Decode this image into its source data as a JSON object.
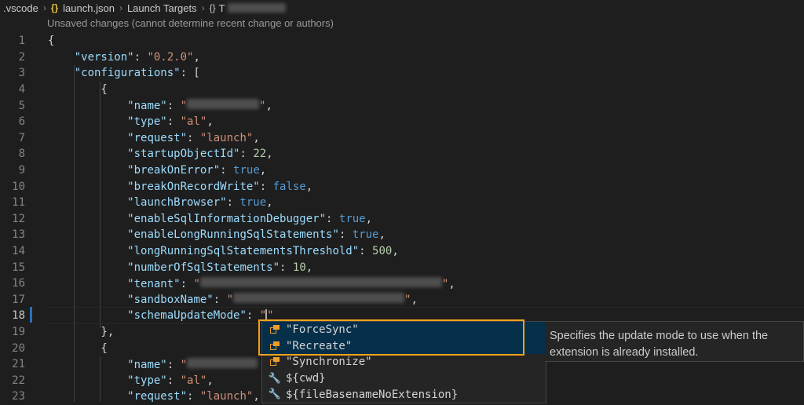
{
  "breadcrumb": {
    "items": [
      ".vscode",
      "launch.json",
      "Launch Targets"
    ],
    "last_prefix": "T"
  },
  "codelens": "Unsaved changes (cannot determine recent change or authors)",
  "editor": {
    "active_line": "18",
    "lines": [
      {
        "ln": "1"
      },
      {
        "ln": "2"
      },
      {
        "ln": "3"
      },
      {
        "ln": "4"
      },
      {
        "ln": "5"
      },
      {
        "ln": "6"
      },
      {
        "ln": "7"
      },
      {
        "ln": "8"
      },
      {
        "ln": "9"
      },
      {
        "ln": "10"
      },
      {
        "ln": "11"
      },
      {
        "ln": "12"
      },
      {
        "ln": "13"
      },
      {
        "ln": "14"
      },
      {
        "ln": "15"
      },
      {
        "ln": "16"
      },
      {
        "ln": "17"
      },
      {
        "ln": "18"
      },
      {
        "ln": "19"
      },
      {
        "ln": "20"
      },
      {
        "ln": "21"
      },
      {
        "ln": "22"
      },
      {
        "ln": "23"
      }
    ],
    "tokens": {
      "version_key": "\"version\"",
      "version_val": "\"0.2.0\"",
      "configurations_key": "\"configurations\"",
      "name_key": "\"name\"",
      "type_key": "\"type\"",
      "type_val": "\"al\"",
      "request_key": "\"request\"",
      "request_val": "\"launch\"",
      "startupObjectId_key": "\"startupObjectId\"",
      "startupObjectId_val": "22",
      "breakOnError_key": "\"breakOnError\"",
      "breakOnError_val": "true",
      "breakOnRecordWrite_key": "\"breakOnRecordWrite\"",
      "breakOnRecordWrite_val": "false",
      "launchBrowser_key": "\"launchBrowser\"",
      "launchBrowser_val": "true",
      "enableSqlInformationDebugger_key": "\"enableSqlInformationDebugger\"",
      "enableSqlInformationDebugger_val": "true",
      "enableLongRunningSqlStatements_key": "\"enableLongRunningSqlStatements\"",
      "enableLongRunningSqlStatements_val": "true",
      "longRunningSqlStatementsThreshold_key": "\"longRunningSqlStatementsThreshold\"",
      "longRunningSqlStatementsThreshold_val": "500",
      "numberOfSqlStatements_key": "\"numberOfSqlStatements\"",
      "numberOfSqlStatements_val": "10",
      "tenant_key": "\"tenant\"",
      "sandboxName_key": "\"sandboxName\"",
      "schemaUpdateMode_key": "\"schemaUpdateMode\""
    }
  },
  "suggest": {
    "items": [
      {
        "icon": "enum-member-icon",
        "label": "\"ForceSync\""
      },
      {
        "icon": "enum-member-icon",
        "label": "\"Recreate\""
      },
      {
        "icon": "enum-member-icon",
        "label": "\"Synchronize\""
      },
      {
        "icon": "wrench-icon",
        "label": "${cwd}"
      },
      {
        "icon": "wrench-icon",
        "label": "${fileBasenameNoExtension}"
      }
    ],
    "details": "Specifies the update mode to use when the extension is already installed."
  },
  "colors": {
    "highlight_box": "#f0a21c",
    "selected_row": "#062f4a",
    "key": "#9cdcfe",
    "string": "#ce9178",
    "number": "#b5cea8",
    "boolean": "#569cd6"
  }
}
